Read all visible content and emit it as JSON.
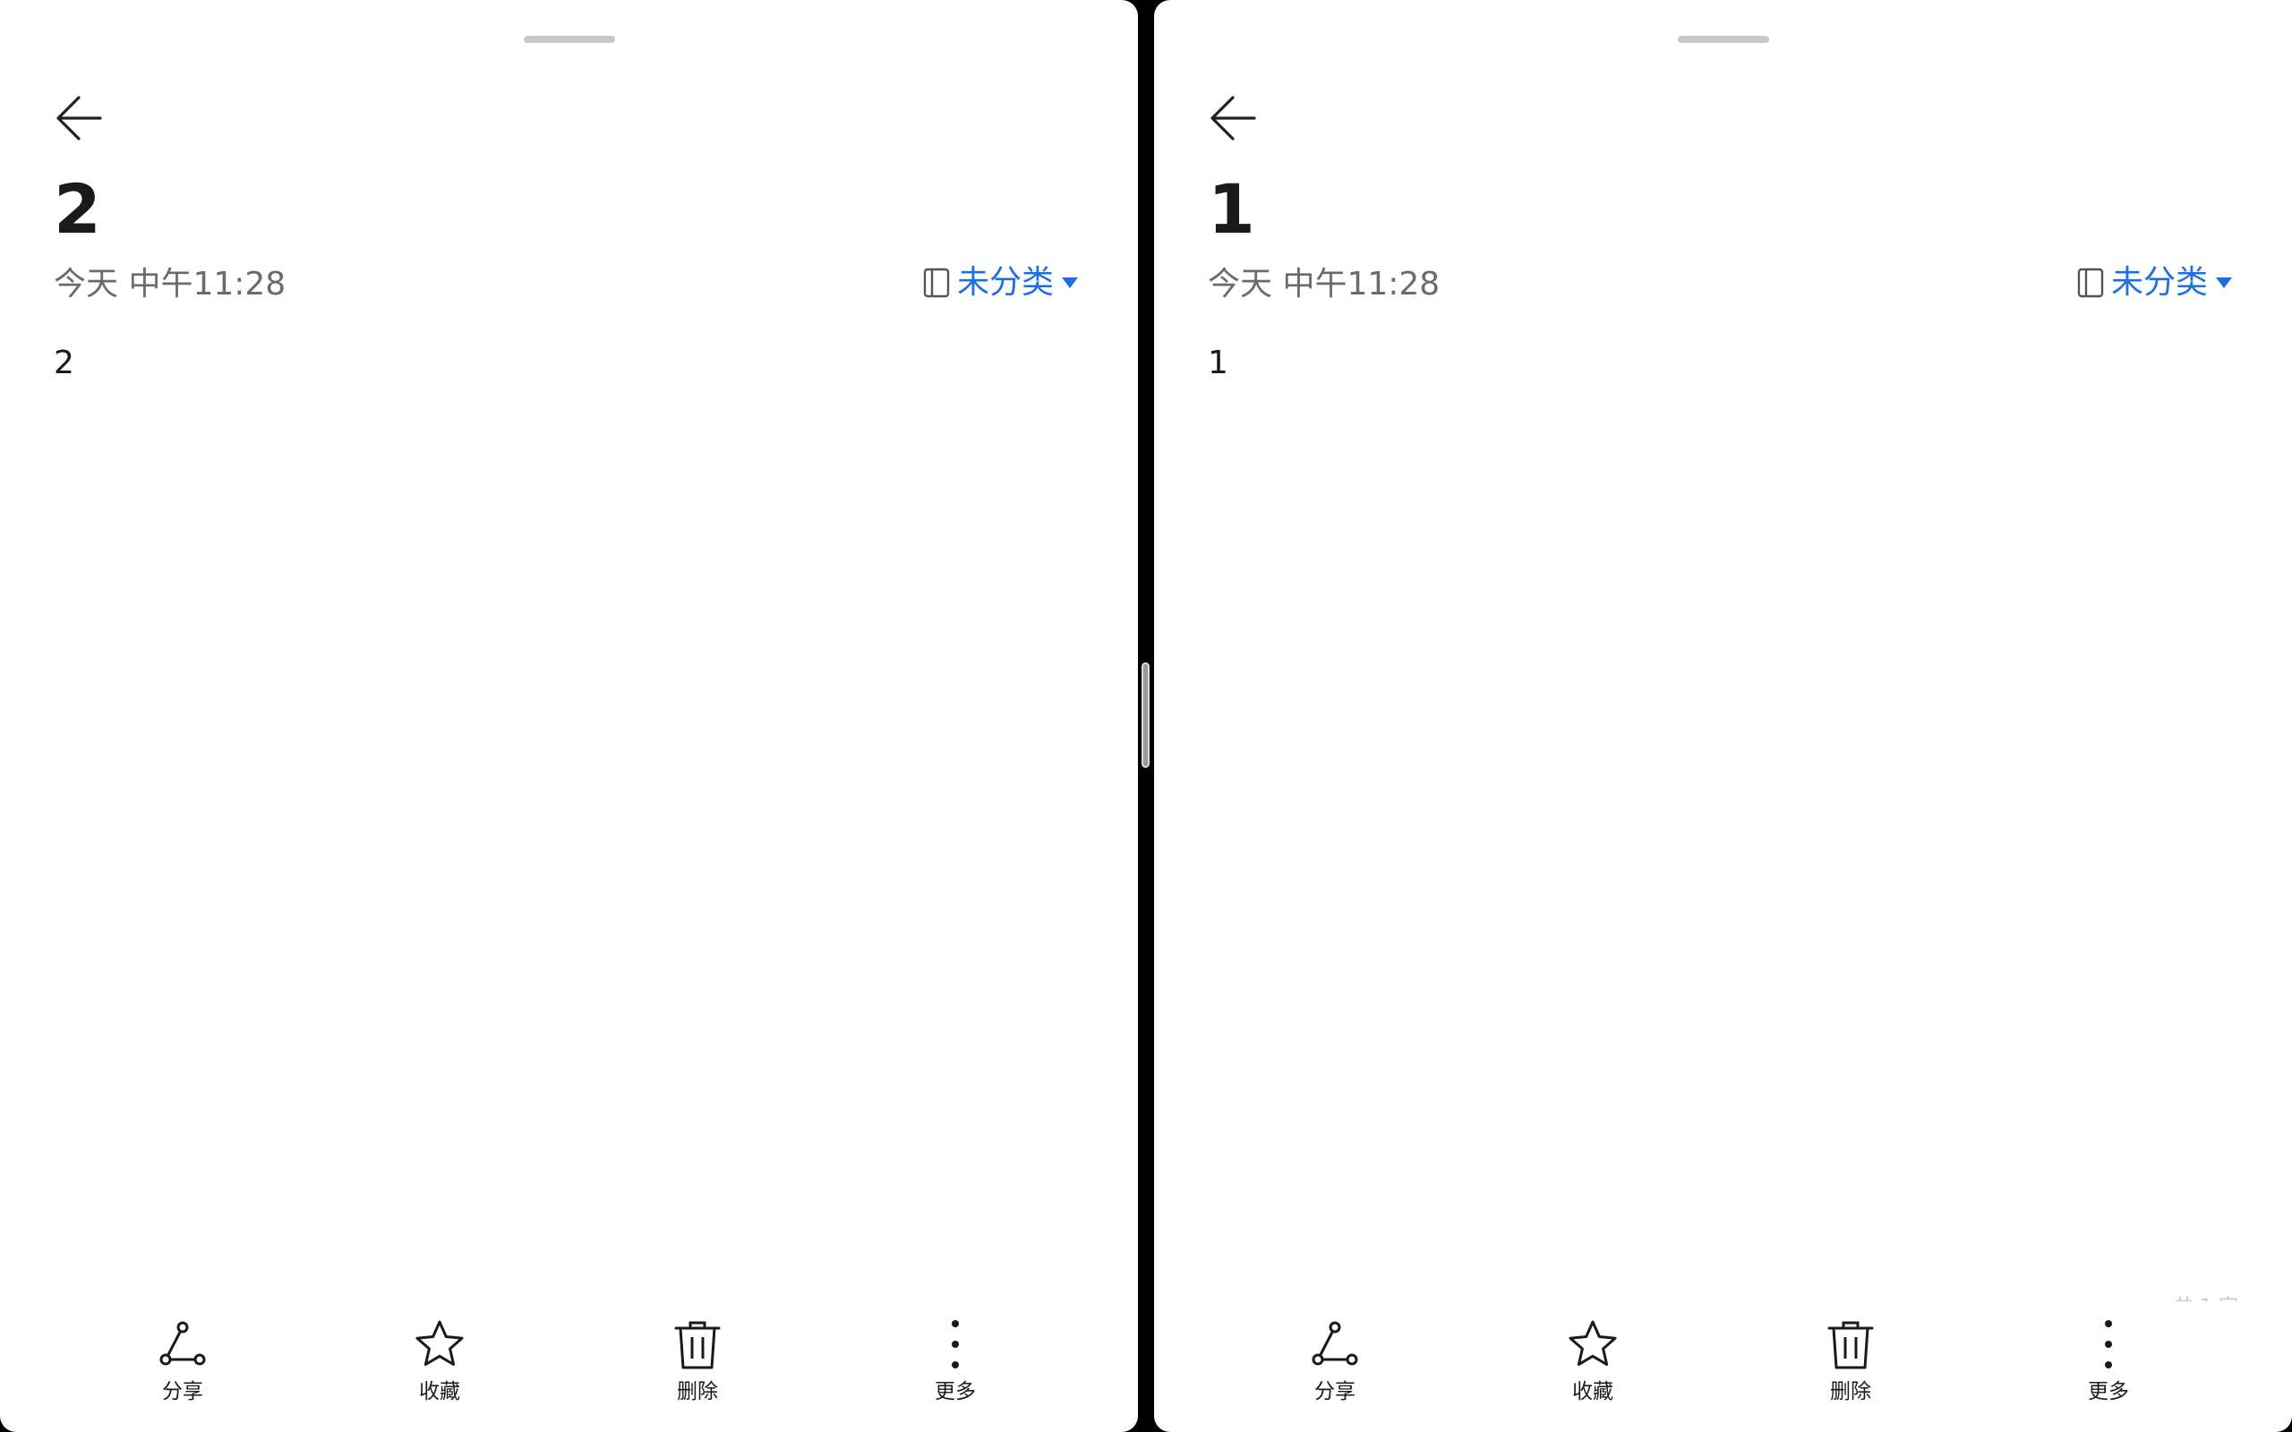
{
  "left": {
    "title": "2",
    "date": "今天 中午11:28",
    "category": "未分类",
    "body": "2",
    "toolbar": {
      "share": "分享",
      "favorite": "收藏",
      "delete": "删除",
      "more": "更多"
    }
  },
  "right": {
    "title": "1",
    "date": "今天 中午11:28",
    "category": "未分类",
    "body": "1",
    "word_count": "共 1 字",
    "toolbar": {
      "share": "分享",
      "favorite": "收藏",
      "delete": "删除",
      "more": "更多"
    }
  },
  "icons": {
    "back": "arrow-left-icon",
    "notebook": "notebook-icon",
    "dropdown": "triangle-down-icon",
    "share": "share-icon",
    "favorite": "star-icon",
    "delete": "trash-icon",
    "more": "more-vertical-icon"
  },
  "colors": {
    "accent": "#1f6fe0",
    "text": "#1a1a1a",
    "secondary_text": "#6b6b6b",
    "background": "#ffffff",
    "divider": "#000000"
  }
}
